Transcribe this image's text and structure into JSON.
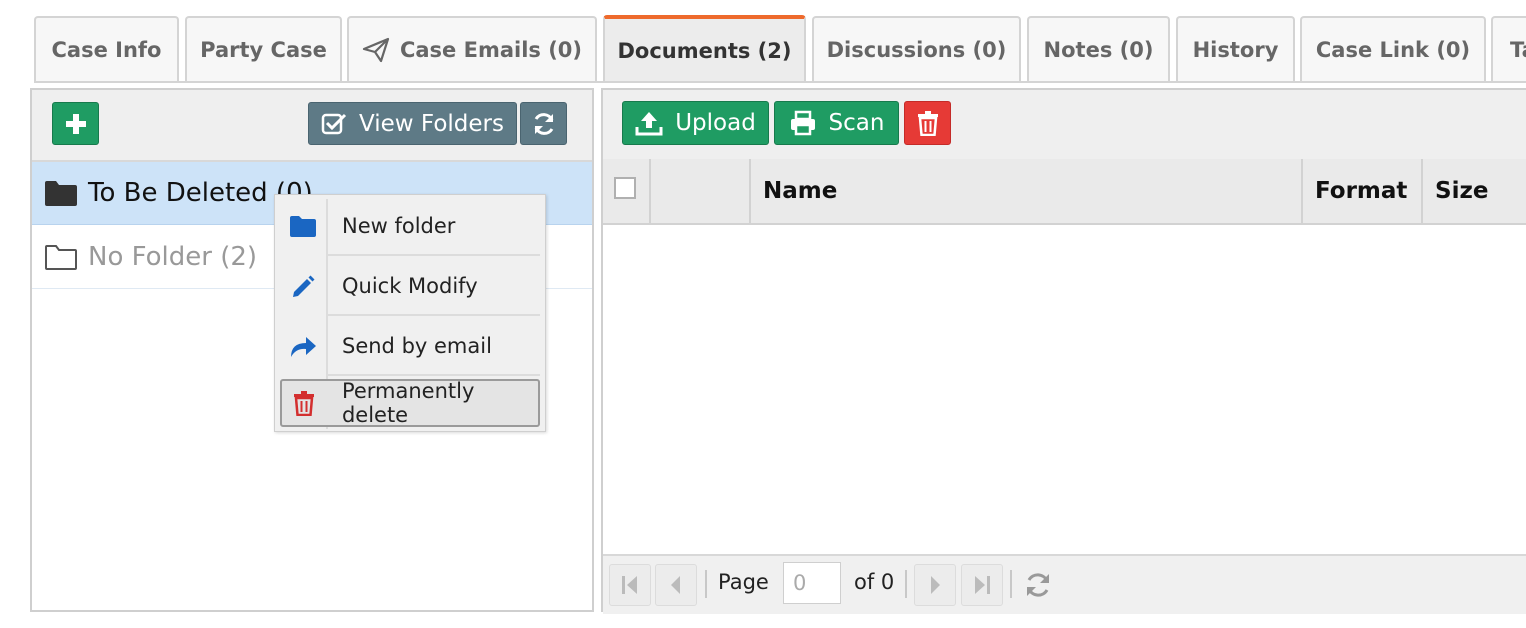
{
  "tabs": [
    {
      "label": "Case Info"
    },
    {
      "label": "Party Case"
    },
    {
      "label": "Case Emails (0)",
      "icon": "paper-plane-icon"
    },
    {
      "label": "Documents (2)",
      "active": true
    },
    {
      "label": "Discussions (0)"
    },
    {
      "label": "Notes (0)"
    },
    {
      "label": "History"
    },
    {
      "label": "Case Link (0)"
    },
    {
      "label": "Ta"
    }
  ],
  "folders_toolbar": {
    "add_icon": "plus-icon",
    "view_folders_label": "View Folders",
    "view_folders_icon": "check-square-icon",
    "refresh_icon": "refresh-icon"
  },
  "folders": [
    {
      "name": "To Be Deleted (0)",
      "icon": "folder-filled-icon",
      "selected": true
    },
    {
      "name": "No Folder (2)",
      "icon": "folder-outline-icon",
      "selected": false
    }
  ],
  "context_menu": {
    "items": [
      {
        "label": "New folder",
        "icon": "folder-icon"
      },
      {
        "label": "Quick Modify",
        "icon": "pencil-icon"
      },
      {
        "label": "Send by email",
        "icon": "share-arrow-icon"
      },
      {
        "label": "Permanently delete",
        "icon": "trash-icon",
        "hovered": true
      }
    ]
  },
  "documents_toolbar": {
    "upload_label": "Upload",
    "scan_label": "Scan",
    "delete_icon": "trash-icon"
  },
  "grid": {
    "columns": [
      "Name",
      "Format",
      "Size"
    ],
    "rows": []
  },
  "pager": {
    "page_label": "Page",
    "page_value": "0",
    "of_label": "of 0"
  },
  "colors": {
    "accent_tab": "#ee6a2c",
    "green_button": "#1f9c63",
    "slate_button": "#5e7a86",
    "red_button": "#e63a36",
    "selected_row": "#cde3f8",
    "menu_icon_blue": "#1a66c2",
    "menu_icon_red": "#d32f2f"
  }
}
